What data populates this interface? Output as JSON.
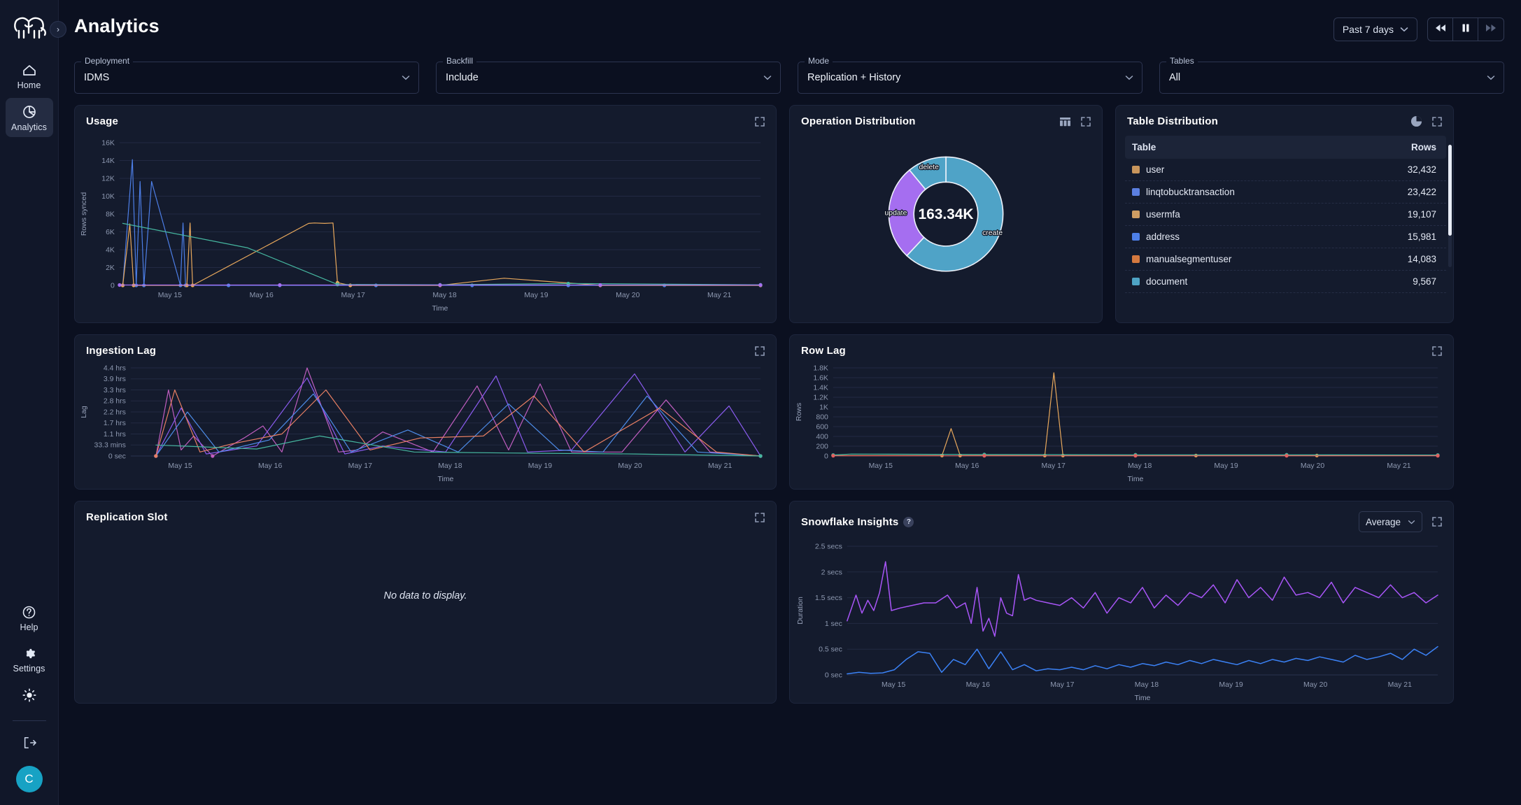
{
  "sidebar": {
    "logo_name": "elephant-logo",
    "items": [
      {
        "label": "Home",
        "icon": "home-icon",
        "active": false
      },
      {
        "label": "Analytics",
        "icon": "pie-chart-icon",
        "active": true
      }
    ],
    "bottom_items": [
      {
        "label": "Help",
        "icon": "question-circle-icon"
      },
      {
        "label": "Settings",
        "icon": "gear-icon"
      }
    ],
    "theme_toggle_icon": "sun-icon",
    "logout_icon": "logout-icon",
    "avatar_initial": "C",
    "collapse_icon": "chevron-right-icon"
  },
  "header": {
    "title": "Analytics",
    "range_label": "Past 7 days",
    "range_chevron": "chevron-down-icon",
    "transport": [
      {
        "name": "rewind-button",
        "icon": "rewind-icon"
      },
      {
        "name": "pause-button",
        "icon": "pause-icon"
      },
      {
        "name": "fast-forward-button",
        "icon": "fast-forward-icon"
      }
    ]
  },
  "filters": [
    {
      "label": "Deployment",
      "value": "IDMS"
    },
    {
      "label": "Backfill",
      "value": "Include"
    },
    {
      "label": "Mode",
      "value": "Replication + History"
    },
    {
      "label": "Tables",
      "value": "All"
    }
  ],
  "cards": {
    "usage": {
      "title": "Usage",
      "expand_icon": "expand-icon"
    },
    "operation_distribution": {
      "title": "Operation Distribution",
      "table_icon": "table-view-icon",
      "expand_icon": "expand-icon"
    },
    "table_distribution": {
      "title": "Table Distribution",
      "pie_icon": "pie-view-icon",
      "expand_icon": "expand-icon"
    },
    "ingestion_lag": {
      "title": "Ingestion Lag",
      "expand_icon": "expand-icon"
    },
    "row_lag": {
      "title": "Row Lag",
      "expand_icon": "expand-icon"
    },
    "replication_slot": {
      "title": "Replication Slot",
      "expand_icon": "expand-icon",
      "empty_message": "No data to display."
    },
    "snowflake_insights": {
      "title": "Snowflake Insights",
      "help_icon": "question-mark-icon",
      "aggregate_value": "Average",
      "expand_icon": "expand-icon"
    }
  },
  "table_distribution": {
    "columns": [
      "Table",
      "Rows"
    ],
    "rows": [
      {
        "name": "user",
        "rows": "32,432",
        "color": "#c8955c"
      },
      {
        "name": "linqtobucktransaction",
        "rows": "23,422",
        "color": "#5b7fe0"
      },
      {
        "name": "usermfa",
        "rows": "19,107",
        "color": "#cf9d63"
      },
      {
        "name": "address",
        "rows": "15,981",
        "color": "#4d7fe8"
      },
      {
        "name": "manualsegmentuser",
        "rows": "14,083",
        "color": "#d4793f"
      },
      {
        "name": "document",
        "rows": "9,567",
        "color": "#4ea3c4"
      }
    ]
  },
  "chart_data": [
    {
      "id": "usage",
      "type": "line",
      "title": "Usage",
      "xlabel": "Time",
      "ylabel": "Rows synced",
      "xticks": [
        "May 15",
        "May 16",
        "May 17",
        "May 18",
        "May 19",
        "May 20",
        "May 21"
      ],
      "yticks": [
        "0",
        "2K",
        "4K",
        "6K",
        "8K",
        "10K",
        "12K",
        "14K",
        "16K"
      ],
      "ylim": [
        0,
        16000
      ],
      "grid": true,
      "series": [
        {
          "name": "blue-spikes",
          "color": "#4d7fe8",
          "x": [
            0.5,
            2.0,
            2.6,
            3.2,
            3.8,
            5.0,
            9.5,
            9.9,
            10.3,
            17,
            25,
            40,
            55,
            70,
            85,
            100
          ],
          "values": [
            0,
            14100,
            0,
            11650,
            0,
            11650,
            0,
            7000,
            0,
            0,
            0,
            0,
            0,
            0,
            0,
            0
          ]
        },
        {
          "name": "orange-spikes",
          "color": "#e8a85c",
          "x": [
            0.5,
            1.6,
            2.2,
            10.5,
            11.0,
            11.4,
            29.5,
            30.4,
            32.0,
            33.3,
            34.0,
            36,
            50,
            60,
            75,
            100
          ],
          "values": [
            0,
            6900,
            0,
            0,
            7000,
            0,
            6950,
            7000,
            6950,
            7000,
            300,
            0,
            0,
            800,
            0,
            0
          ]
        },
        {
          "name": "green-decay",
          "color": "#46b7a0",
          "x": [
            0.5,
            20,
            34,
            50,
            70,
            100
          ],
          "values": [
            6950,
            4200,
            100,
            60,
            200,
            60
          ]
        },
        {
          "name": "purple-baseline",
          "color": "#a56ef0",
          "x": [
            0,
            25,
            50,
            75,
            100
          ],
          "values": [
            40,
            40,
            40,
            40,
            40
          ]
        }
      ]
    },
    {
      "id": "operation_distribution",
      "type": "pie",
      "title": "Operation Distribution",
      "center_value": "163.34K",
      "labels": [
        "create",
        "update",
        "delete"
      ],
      "values": [
        62,
        27,
        11
      ],
      "colors": [
        "#4fa3c7",
        "#a56ef0",
        "#4fa3c7"
      ]
    },
    {
      "id": "ingestion_lag",
      "type": "line",
      "title": "Ingestion Lag",
      "xlabel": "Time",
      "ylabel": "Lag",
      "xticks": [
        "May 15",
        "May 16",
        "May 17",
        "May 18",
        "May 19",
        "May 20",
        "May 21"
      ],
      "yticks": [
        "0 sec",
        "33.3 mins",
        "1.1 hrs",
        "1.7 hrs",
        "2.2 hrs",
        "2.8 hrs",
        "3.3 hrs",
        "3.9 hrs",
        "4.4 hrs"
      ],
      "ylim": [
        0,
        4.4
      ],
      "grid": true,
      "series": [
        {
          "name": "magenta",
          "color": "#c05ec0",
          "x": [
            4,
            6,
            8,
            10,
            13,
            18,
            21,
            24,
            28,
            33,
            36,
            40,
            48,
            55,
            60,
            65,
            70,
            78,
            85,
            92,
            100
          ],
          "values": [
            0,
            3.3,
            0.3,
            1.0,
            0,
            0.9,
            1.5,
            0.2,
            4.4,
            0.2,
            0.3,
            1.2,
            0.2,
            3.5,
            0.3,
            3.6,
            0.2,
            0.2,
            2.8,
            0.2,
            0
          ]
        },
        {
          "name": "purple",
          "color": "#8b5cf0",
          "x": [
            4,
            8,
            12,
            20,
            28,
            34,
            40,
            50,
            58,
            63,
            70,
            80,
            88,
            95,
            100
          ],
          "values": [
            0,
            2.4,
            0.1,
            0.5,
            3.9,
            0.1,
            0.5,
            0.2,
            4.0,
            0.2,
            0.3,
            4.1,
            0.2,
            2.5,
            0
          ]
        },
        {
          "name": "blue",
          "color": "#4d8ce8",
          "x": [
            4,
            9,
            14,
            22,
            29,
            35,
            44,
            52,
            60,
            68,
            75,
            82,
            90,
            100
          ],
          "values": [
            0,
            2.2,
            0.2,
            0.8,
            3.1,
            0.2,
            1.3,
            0.2,
            2.6,
            0.3,
            0.2,
            3.0,
            0.2,
            0
          ]
        },
        {
          "name": "salmon",
          "color": "#e87f63",
          "x": [
            4,
            7,
            11,
            16,
            24,
            31,
            38,
            46,
            56,
            64,
            72,
            84,
            93,
            100
          ],
          "values": [
            0,
            3.3,
            0.2,
            0.6,
            1.1,
            3.3,
            0.3,
            0.9,
            1.0,
            3.0,
            0.2,
            2.4,
            0.2,
            0
          ]
        },
        {
          "name": "teal-decay",
          "color": "#46b7a0",
          "x": [
            4,
            20,
            30,
            45,
            60,
            80,
            100
          ],
          "values": [
            0.55,
            0.35,
            1.0,
            0.2,
            0.15,
            0.1,
            0
          ]
        }
      ]
    },
    {
      "id": "row_lag",
      "type": "line",
      "title": "Row Lag",
      "xlabel": "Time",
      "ylabel": "Rows",
      "xticks": [
        "May 15",
        "May 16",
        "May 17",
        "May 18",
        "May 19",
        "May 20",
        "May 21"
      ],
      "yticks": [
        "0",
        "200",
        "400",
        "600",
        "800",
        "1K",
        "1.2K",
        "1.4K",
        "1.6K",
        "1.8K"
      ],
      "ylim": [
        0,
        1800
      ],
      "grid": true,
      "series": [
        {
          "name": "orange-spikes",
          "color": "#e8a85c",
          "x": [
            0,
            18,
            19.5,
            21,
            35,
            36.5,
            38,
            60,
            80,
            100
          ],
          "values": [
            10,
            10,
            560,
            10,
            10,
            1700,
            10,
            10,
            10,
            10
          ]
        },
        {
          "name": "teal-baseline",
          "color": "#46b7a0",
          "x": [
            0,
            3,
            25,
            50,
            75,
            100
          ],
          "values": [
            20,
            40,
            30,
            25,
            25,
            20
          ]
        },
        {
          "name": "red-baseline",
          "color": "#e35f5f",
          "x": [
            0,
            25,
            50,
            75,
            100
          ],
          "values": [
            5,
            5,
            5,
            5,
            5
          ]
        }
      ]
    },
    {
      "id": "snowflake_insights",
      "type": "line",
      "title": "Snowflake Insights",
      "aggregate": "Average",
      "xlabel": "Time",
      "ylabel": "Duration",
      "xticks": [
        "May 15",
        "May 16",
        "May 17",
        "May 18",
        "May 19",
        "May 20",
        "May 21"
      ],
      "yticks": [
        "0 sec",
        "0.5 sec",
        "1 sec",
        "1.5 secs",
        "2 secs",
        "2.5 secs"
      ],
      "ylim": [
        0,
        2.5
      ],
      "grid": true,
      "series": [
        {
          "name": "purple-duration",
          "color": "#a855f7",
          "x": [
            0,
            1.5,
            2.5,
            3.5,
            4.5,
            5.5,
            6.5,
            7.5,
            9,
            11,
            13,
            15,
            17,
            18.5,
            20,
            21,
            22,
            23,
            24,
            25,
            26,
            27,
            28,
            29,
            30,
            31,
            32,
            34,
            36,
            38,
            40,
            42,
            44,
            46,
            48,
            50,
            52,
            54,
            56,
            58,
            60,
            62,
            64,
            66,
            68,
            70,
            72,
            74,
            76,
            78,
            80,
            82,
            84,
            86,
            88,
            90,
            92,
            94,
            96,
            98,
            100
          ],
          "values": [
            1.05,
            1.55,
            1.2,
            1.45,
            1.25,
            1.6,
            2.2,
            1.25,
            1.3,
            1.35,
            1.4,
            1.4,
            1.55,
            1.3,
            1.4,
            1.0,
            1.7,
            0.85,
            1.1,
            0.75,
            1.5,
            1.2,
            1.15,
            1.95,
            1.45,
            1.5,
            1.45,
            1.4,
            1.35,
            1.5,
            1.3,
            1.6,
            1.2,
            1.5,
            1.4,
            1.7,
            1.3,
            1.55,
            1.35,
            1.6,
            1.5,
            1.75,
            1.4,
            1.85,
            1.5,
            1.7,
            1.45,
            1.9,
            1.55,
            1.6,
            1.5,
            1.8,
            1.4,
            1.7,
            1.6,
            1.5,
            1.75,
            1.5,
            1.6,
            1.4,
            1.55
          ]
        },
        {
          "name": "blue-duration",
          "color": "#3b82f6",
          "x": [
            0,
            2,
            4,
            6,
            8,
            10,
            12,
            14,
            16,
            18,
            20,
            22,
            24,
            26,
            28,
            30,
            32,
            34,
            36,
            38,
            40,
            42,
            44,
            46,
            48,
            50,
            52,
            54,
            56,
            58,
            60,
            62,
            64,
            66,
            68,
            70,
            72,
            74,
            76,
            78,
            80,
            82,
            84,
            86,
            88,
            90,
            92,
            94,
            96,
            98,
            100
          ],
          "values": [
            0.02,
            0.05,
            0.03,
            0.04,
            0.1,
            0.3,
            0.45,
            0.42,
            0.05,
            0.3,
            0.2,
            0.5,
            0.12,
            0.45,
            0.1,
            0.2,
            0.08,
            0.12,
            0.1,
            0.15,
            0.1,
            0.18,
            0.12,
            0.2,
            0.15,
            0.22,
            0.18,
            0.25,
            0.2,
            0.28,
            0.22,
            0.3,
            0.25,
            0.2,
            0.28,
            0.22,
            0.3,
            0.25,
            0.32,
            0.28,
            0.35,
            0.3,
            0.25,
            0.38,
            0.3,
            0.35,
            0.42,
            0.3,
            0.5,
            0.38,
            0.55
          ]
        }
      ]
    }
  ]
}
